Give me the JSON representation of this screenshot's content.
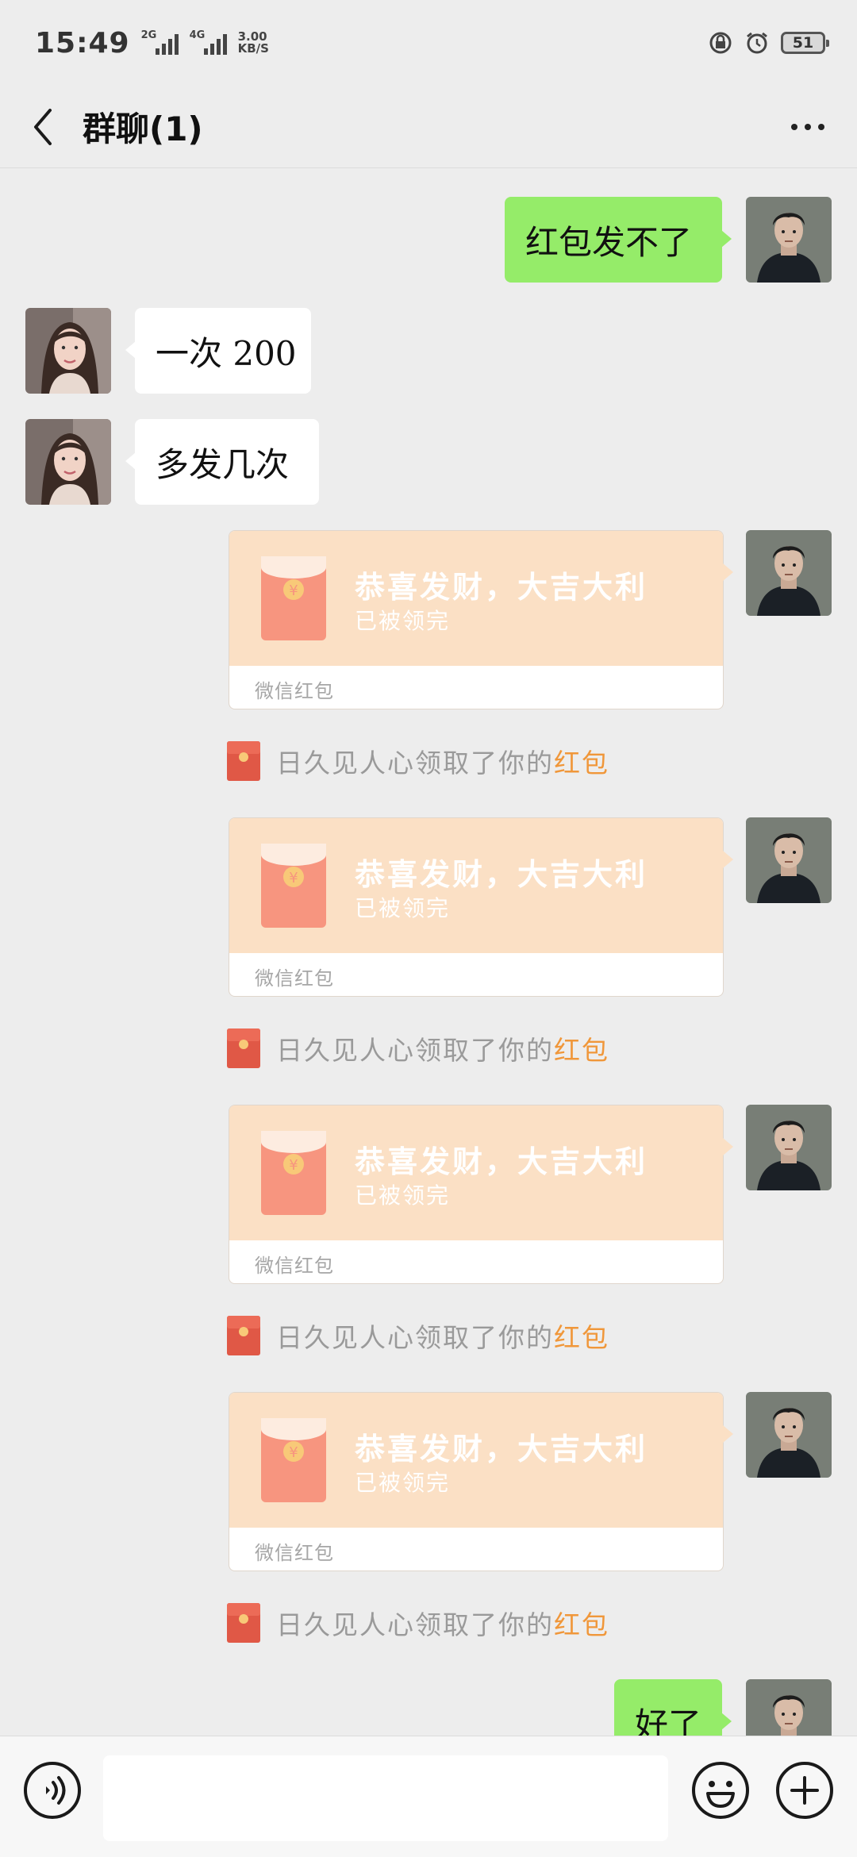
{
  "status_bar": {
    "time": "15:49",
    "signal_1_label": "2G",
    "signal_2_label": "4G",
    "net_speed_value": "3.00",
    "net_speed_unit": "KB/S",
    "battery": "51"
  },
  "header": {
    "title": "群聊(1)"
  },
  "messages": [
    {
      "sender": "me",
      "type": "text",
      "text": "红包发不了"
    },
    {
      "sender": "other",
      "type": "text",
      "text": "一次 200"
    },
    {
      "sender": "other",
      "type": "text",
      "text": "多发几次"
    },
    {
      "sender": "me",
      "type": "red_packet",
      "title": "恭喜发财，大吉大利",
      "status": "已被领完",
      "footer": "微信红包"
    },
    {
      "type": "system",
      "text": "日久见人心领取了你的",
      "link": "红包"
    },
    {
      "sender": "me",
      "type": "red_packet",
      "title": "恭喜发财，大吉大利",
      "status": "已被领完",
      "footer": "微信红包"
    },
    {
      "type": "system",
      "text": "日久见人心领取了你的",
      "link": "红包"
    },
    {
      "sender": "me",
      "type": "red_packet",
      "title": "恭喜发财，大吉大利",
      "status": "已被领完",
      "footer": "微信红包"
    },
    {
      "type": "system",
      "text": "日久见人心领取了你的",
      "link": "红包"
    },
    {
      "sender": "me",
      "type": "red_packet",
      "title": "恭喜发财，大吉大利",
      "status": "已被领完",
      "footer": "微信红包"
    },
    {
      "type": "system",
      "text": "日久见人心领取了你的",
      "link": "红包"
    },
    {
      "sender": "me",
      "type": "text",
      "text": "好了"
    }
  ],
  "icons": {
    "back": "back-arrow-icon",
    "more": "more-dots-icon",
    "voice": "voice-icon",
    "emoji": "emoji-icon",
    "plus": "plus-icon",
    "red_packet": "red-packet-icon"
  },
  "colors": {
    "my_bubble": "#95ec69",
    "other_bubble": "#ffffff",
    "packet_bg": "#fbe0c5",
    "link": "#f0973a",
    "chat_bg": "#ededed"
  }
}
